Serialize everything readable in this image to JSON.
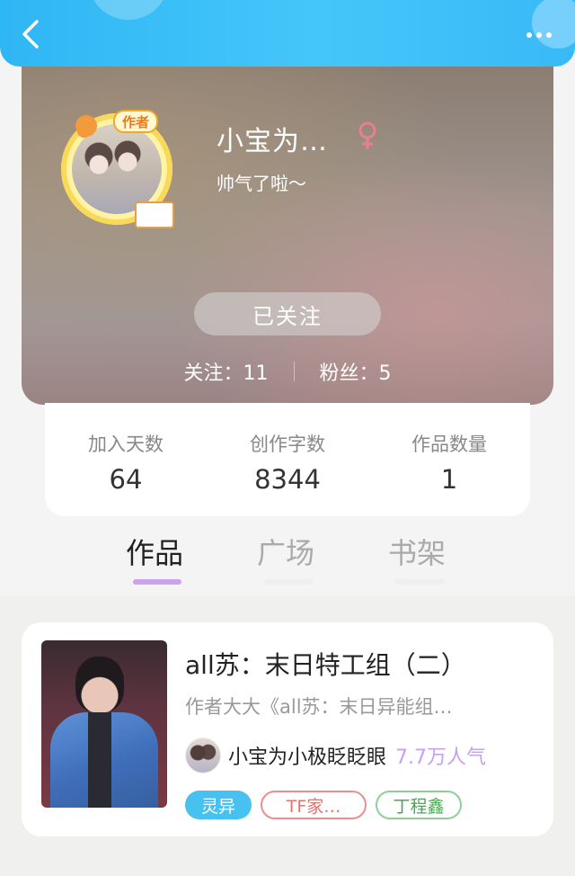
{
  "header": {
    "back_icon": "chevron-left-icon",
    "more_icon": "more-dots-icon"
  },
  "profile": {
    "avatar_badge": "作者",
    "username": "小宝为…",
    "gender_icon": "female-icon",
    "gender_color": "#e8808b",
    "bio": "帅气了啦～",
    "follow_button": "已关注",
    "following_label": "关注：11",
    "fans_label": "粉丝：5"
  },
  "stats": [
    {
      "label": "加入天数",
      "value": "64"
    },
    {
      "label": "创作字数",
      "value": "8344"
    },
    {
      "label": "作品数量",
      "value": "1"
    }
  ],
  "tabs": [
    {
      "label": "作品",
      "active": true
    },
    {
      "label": "广场",
      "active": false
    },
    {
      "label": "书架",
      "active": false
    }
  ],
  "book": {
    "title": "all苏：末日特工组（二）",
    "description": "作者大大《all苏：末日异能组…",
    "author": "小宝为小极眨眨眼",
    "popularity": "7.7万人气",
    "tags": [
      "灵异",
      "TF家…",
      "丁程鑫"
    ]
  },
  "colors": {
    "accent_blue": "#2fb6f4",
    "tab_active_underline": "#c9a4ec",
    "popularity": "#c9a0ef"
  }
}
